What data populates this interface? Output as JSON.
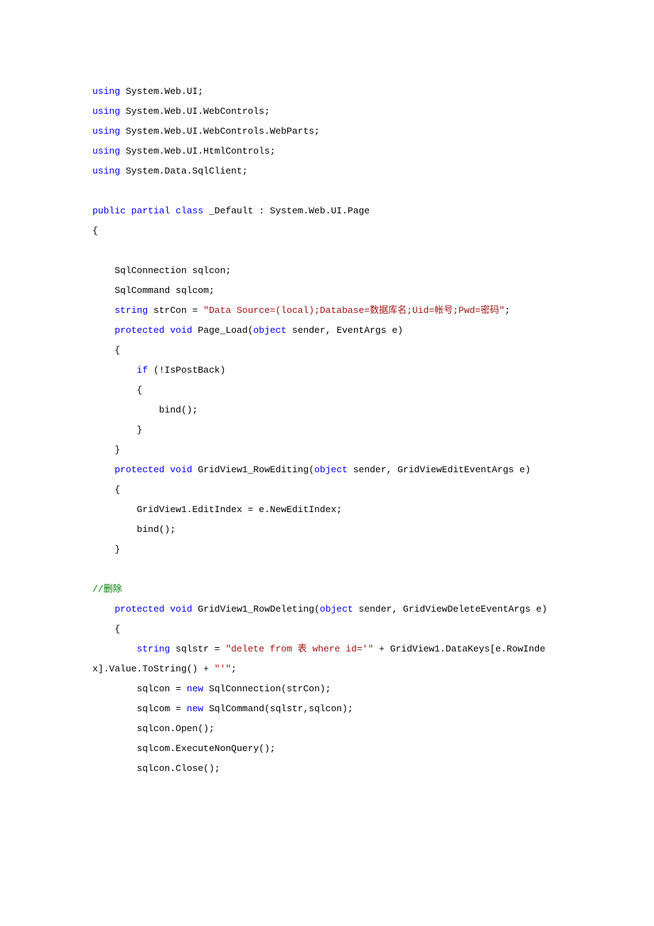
{
  "code": [
    {
      "segments": [
        {
          "c": "kw",
          "t": "using"
        },
        {
          "c": "txt",
          "t": " System.Web.UI;"
        }
      ]
    },
    {
      "segments": [
        {
          "c": "kw",
          "t": "using"
        },
        {
          "c": "txt",
          "t": " System.Web.UI.WebControls;"
        }
      ]
    },
    {
      "segments": [
        {
          "c": "kw",
          "t": "using"
        },
        {
          "c": "txt",
          "t": " System.Web.UI.WebControls.WebParts;"
        }
      ]
    },
    {
      "segments": [
        {
          "c": "kw",
          "t": "using"
        },
        {
          "c": "txt",
          "t": " System.Web.UI.HtmlControls;"
        }
      ]
    },
    {
      "segments": [
        {
          "c": "kw",
          "t": "using"
        },
        {
          "c": "txt",
          "t": " System.Data.SqlClient;"
        }
      ]
    },
    {
      "segments": []
    },
    {
      "segments": [
        {
          "c": "kw",
          "t": "public"
        },
        {
          "c": "txt",
          "t": " "
        },
        {
          "c": "kw",
          "t": "partial"
        },
        {
          "c": "txt",
          "t": " "
        },
        {
          "c": "kw",
          "t": "class"
        },
        {
          "c": "txt",
          "t": " _Default : System.Web.UI.Page"
        }
      ]
    },
    {
      "segments": [
        {
          "c": "txt",
          "t": "{"
        }
      ]
    },
    {
      "segments": []
    },
    {
      "segments": [
        {
          "c": "txt",
          "t": "    SqlConnection sqlcon;"
        }
      ]
    },
    {
      "segments": [
        {
          "c": "txt",
          "t": "    SqlCommand sqlcom;"
        }
      ]
    },
    {
      "segments": [
        {
          "c": "txt",
          "t": "    "
        },
        {
          "c": "kw",
          "t": "string"
        },
        {
          "c": "txt",
          "t": " strCon = "
        },
        {
          "c": "str",
          "t": "\"Data Source=(local);Database=数据库名;Uid=帐号;Pwd=密码\""
        },
        {
          "c": "txt",
          "t": ";"
        }
      ]
    },
    {
      "segments": [
        {
          "c": "txt",
          "t": "    "
        },
        {
          "c": "kw",
          "t": "protected"
        },
        {
          "c": "txt",
          "t": " "
        },
        {
          "c": "kw",
          "t": "void"
        },
        {
          "c": "txt",
          "t": " Page_Load("
        },
        {
          "c": "kw",
          "t": "object"
        },
        {
          "c": "txt",
          "t": " sender, EventArgs e)"
        }
      ]
    },
    {
      "segments": [
        {
          "c": "txt",
          "t": "    {"
        }
      ]
    },
    {
      "segments": [
        {
          "c": "txt",
          "t": "        "
        },
        {
          "c": "kw",
          "t": "if"
        },
        {
          "c": "txt",
          "t": " (!IsPostBack)"
        }
      ]
    },
    {
      "segments": [
        {
          "c": "txt",
          "t": "        {"
        }
      ]
    },
    {
      "segments": [
        {
          "c": "txt",
          "t": "            bind();"
        }
      ]
    },
    {
      "segments": [
        {
          "c": "txt",
          "t": "        }"
        }
      ]
    },
    {
      "segments": [
        {
          "c": "txt",
          "t": "    }"
        }
      ]
    },
    {
      "segments": [
        {
          "c": "txt",
          "t": "    "
        },
        {
          "c": "kw",
          "t": "protected"
        },
        {
          "c": "txt",
          "t": " "
        },
        {
          "c": "kw",
          "t": "void"
        },
        {
          "c": "txt",
          "t": " GridView1_RowEditing("
        },
        {
          "c": "kw",
          "t": "object"
        },
        {
          "c": "txt",
          "t": " sender, GridViewEditEventArgs e)"
        }
      ]
    },
    {
      "segments": [
        {
          "c": "txt",
          "t": "    {"
        }
      ]
    },
    {
      "segments": [
        {
          "c": "txt",
          "t": "        GridView1.EditIndex = e.NewEditIndex;"
        }
      ]
    },
    {
      "segments": [
        {
          "c": "txt",
          "t": "        bind();"
        }
      ]
    },
    {
      "segments": [
        {
          "c": "txt",
          "t": "    }"
        }
      ]
    },
    {
      "segments": []
    },
    {
      "segments": [
        {
          "c": "cmt",
          "t": "//删除"
        }
      ]
    },
    {
      "segments": [
        {
          "c": "txt",
          "t": "    "
        },
        {
          "c": "kw",
          "t": "protected"
        },
        {
          "c": "txt",
          "t": " "
        },
        {
          "c": "kw",
          "t": "void"
        },
        {
          "c": "txt",
          "t": " GridView1_RowDeleting("
        },
        {
          "c": "kw",
          "t": "object"
        },
        {
          "c": "txt",
          "t": " sender, GridViewDeleteEventArgs e)"
        }
      ]
    },
    {
      "segments": [
        {
          "c": "txt",
          "t": "    {"
        }
      ]
    },
    {
      "segments": [
        {
          "c": "txt",
          "t": "        "
        },
        {
          "c": "kw",
          "t": "string"
        },
        {
          "c": "txt",
          "t": " sqlstr = "
        },
        {
          "c": "str",
          "t": "\"delete from 表 where id='\""
        },
        {
          "c": "txt",
          "t": " + GridView1.DataKeys[e.RowIndex].Value.ToString() + "
        },
        {
          "c": "str",
          "t": "\"'\""
        },
        {
          "c": "txt",
          "t": ";"
        }
      ]
    },
    {
      "segments": [
        {
          "c": "txt",
          "t": "        sqlcon = "
        },
        {
          "c": "kw",
          "t": "new"
        },
        {
          "c": "txt",
          "t": " SqlConnection(strCon);"
        }
      ]
    },
    {
      "segments": [
        {
          "c": "txt",
          "t": "        sqlcom = "
        },
        {
          "c": "kw",
          "t": "new"
        },
        {
          "c": "txt",
          "t": " SqlCommand(sqlstr,sqlcon);"
        }
      ]
    },
    {
      "segments": [
        {
          "c": "txt",
          "t": "        sqlcon.Open();"
        }
      ]
    },
    {
      "segments": [
        {
          "c": "txt",
          "t": "        sqlcom.ExecuteNonQuery();"
        }
      ]
    },
    {
      "segments": [
        {
          "c": "txt",
          "t": "        sqlcon.Close();"
        }
      ]
    }
  ]
}
